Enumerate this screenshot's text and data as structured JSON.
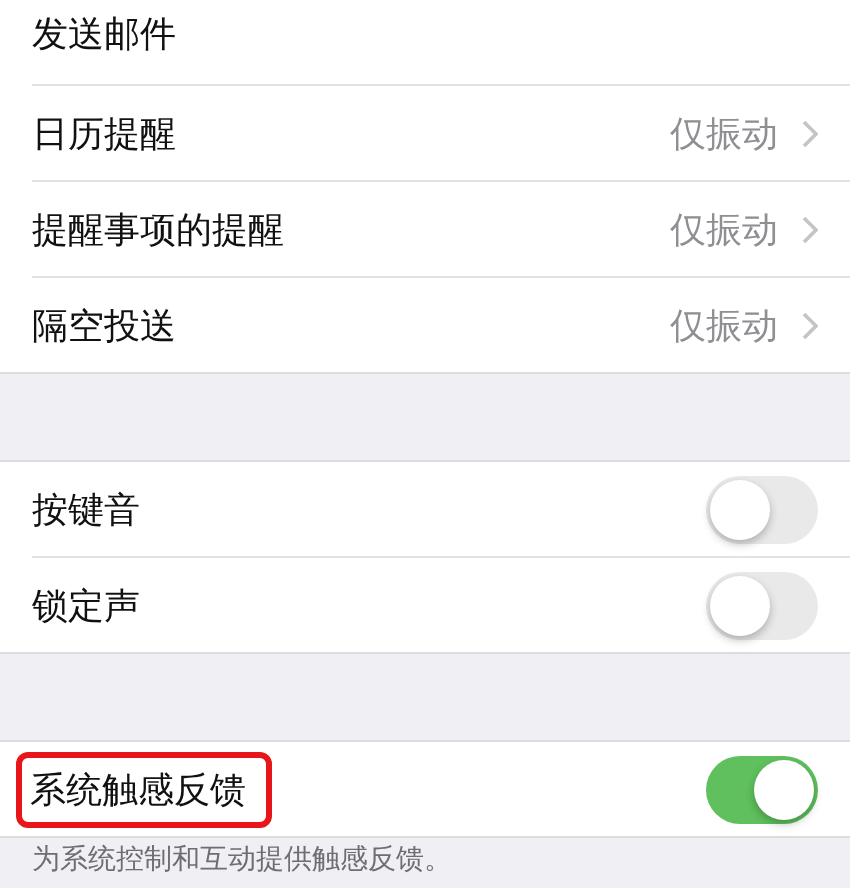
{
  "groups": [
    {
      "rows": [
        {
          "kind": "link",
          "label": "发送邮件"
        },
        {
          "kind": "link",
          "label": "日历提醒",
          "value": "仅振动"
        },
        {
          "kind": "link",
          "label": "提醒事项的提醒",
          "value": "仅振动"
        },
        {
          "kind": "link",
          "label": "隔空投送",
          "value": "仅振动"
        }
      ]
    },
    {
      "rows": [
        {
          "kind": "switch",
          "label": "按键音",
          "on": false
        },
        {
          "kind": "switch",
          "label": "锁定声",
          "on": false
        }
      ]
    },
    {
      "rows": [
        {
          "kind": "switch",
          "label": "系统触感反馈",
          "on": true,
          "highlighted": true
        }
      ],
      "footer": "为系统控制和互动提供触感反馈。"
    }
  ]
}
